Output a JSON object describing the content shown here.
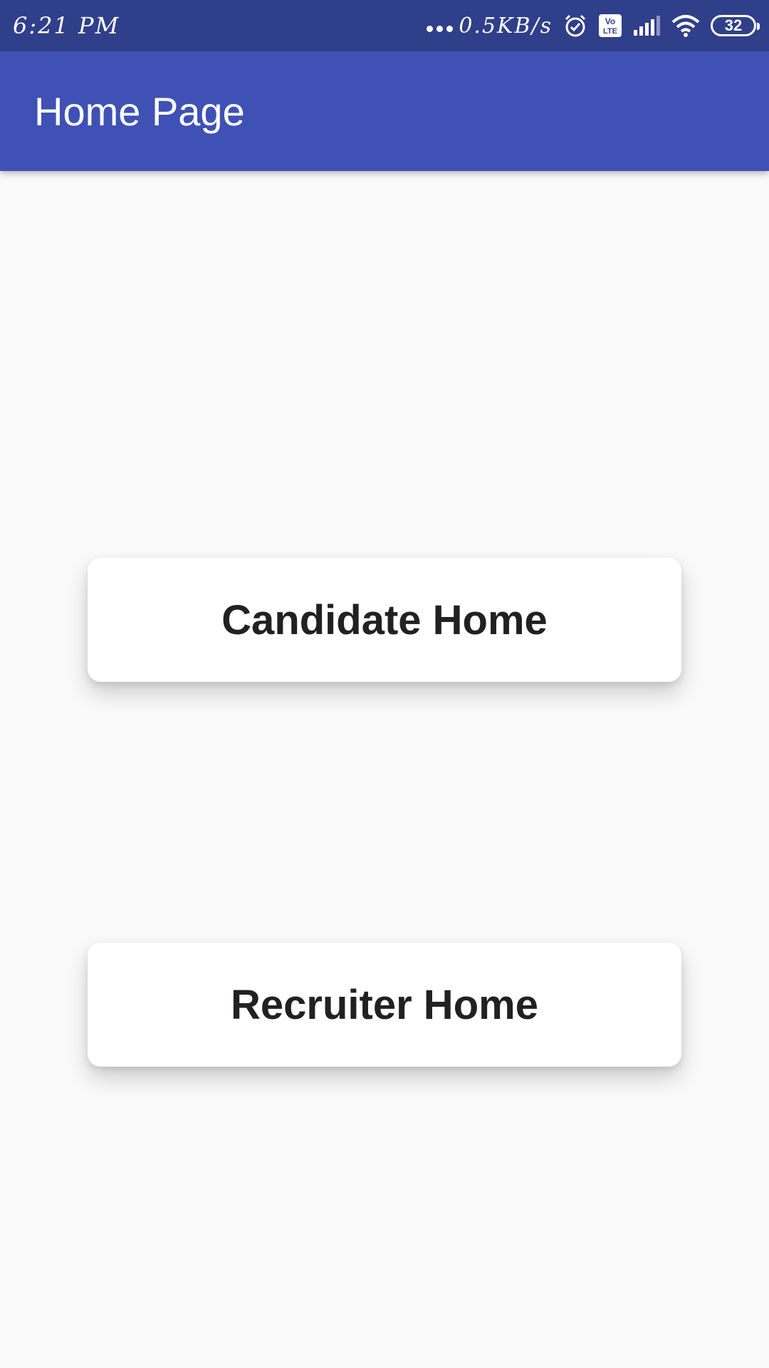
{
  "status_bar": {
    "time": "6:21 PM",
    "network_speed": "0.5KB/s",
    "battery_level": "32",
    "icons": [
      "more-dots-icon",
      "alarm-icon",
      "volte-icon",
      "signal-icon",
      "wifi-icon",
      "battery-icon"
    ],
    "volte_line1": "Vo",
    "volte_line2": "LTE"
  },
  "app_bar": {
    "title": "Home Page",
    "color": "#3f51b5"
  },
  "main": {
    "candidate_button_label": "Candidate Home",
    "recruiter_button_label": "Recruiter Home"
  },
  "colors": {
    "status_bar": "#303f8a",
    "app_bar": "#3f51b5",
    "background": "#fafafa",
    "button_text": "#212121"
  }
}
